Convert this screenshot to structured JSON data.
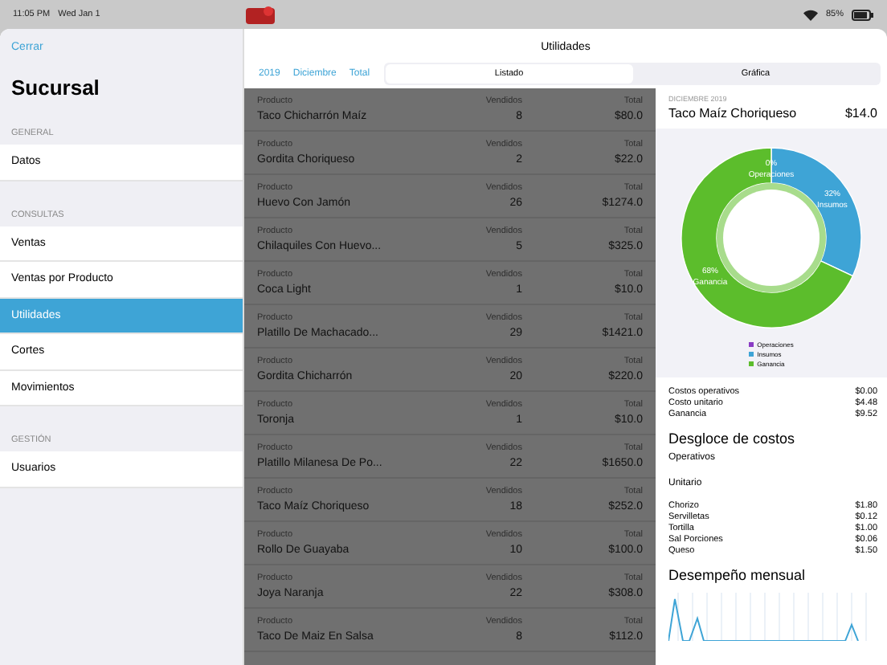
{
  "status_bar": {
    "time": "11:05 PM",
    "date": "Wed Jan 1",
    "battery": "85%"
  },
  "sidebar": {
    "close": "Cerrar",
    "title": "Sucursal",
    "sections": [
      {
        "heading": "GENERAL",
        "items": [
          {
            "label": "Datos",
            "selected": false
          }
        ]
      },
      {
        "heading": "CONSULTAS",
        "items": [
          {
            "label": "Ventas",
            "selected": false
          },
          {
            "label": "Ventas por Producto",
            "selected": false
          },
          {
            "label": "Utilidades",
            "selected": true
          },
          {
            "label": "Cortes",
            "selected": false
          },
          {
            "label": "Movimientos",
            "selected": false
          }
        ]
      },
      {
        "heading": "GESTIÓN",
        "items": [
          {
            "label": "Usuarios",
            "selected": false
          }
        ]
      }
    ]
  },
  "main": {
    "title": "Utilidades",
    "filters": [
      "2019",
      "Diciembre",
      "Total"
    ],
    "segments": [
      {
        "label": "Listado",
        "selected": true
      },
      {
        "label": "Gráfica",
        "selected": false
      }
    ]
  },
  "table": {
    "rows": [
      {
        "label_1": "Producto",
        "name": "Taco Chicharrón Maíz",
        "label_2": "Vendidos",
        "sold": "8",
        "label_3": "Total",
        "total": "$80.0"
      },
      {
        "label_1": "Producto",
        "name": "Gordita Choriqueso",
        "label_2": "Vendidos",
        "sold": "2",
        "label_3": "Total",
        "total": "$22.0"
      },
      {
        "label_1": "Producto",
        "name": "Huevo Con Jamón",
        "label_2": "Vendidos",
        "sold": "26",
        "label_3": "Total",
        "total": "$1274.0"
      },
      {
        "label_1": "Producto",
        "name": "Chilaquiles Con Huevo...",
        "label_2": "Vendidos",
        "sold": "5",
        "label_3": "Total",
        "total": "$325.0"
      },
      {
        "label_1": "Producto",
        "name": "Coca Light",
        "label_2": "Vendidos",
        "sold": "1",
        "label_3": "Total",
        "total": "$10.0"
      },
      {
        "label_1": "Producto",
        "name": "Platillo De Machacado...",
        "label_2": "Vendidos",
        "sold": "29",
        "label_3": "Total",
        "total": "$1421.0"
      },
      {
        "label_1": "Producto",
        "name": "Gordita Chicharrón",
        "label_2": "Vendidos",
        "sold": "20",
        "label_3": "Total",
        "total": "$220.0"
      },
      {
        "label_1": "Producto",
        "name": "Toronja",
        "label_2": "Vendidos",
        "sold": "1",
        "label_3": "Total",
        "total": "$10.0"
      },
      {
        "label_1": "Producto",
        "name": "Platillo Milanesa De Po...",
        "label_2": "Vendidos",
        "sold": "22",
        "label_3": "Total",
        "total": "$1650.0"
      },
      {
        "label_1": "Producto",
        "name": "Taco Maíz Choriqueso",
        "label_2": "Vendidos",
        "sold": "18",
        "label_3": "Total",
        "total": "$252.0"
      },
      {
        "label_1": "Producto",
        "name": "Rollo De Guayaba",
        "label_2": "Vendidos",
        "sold": "10",
        "label_3": "Total",
        "total": "$100.0"
      },
      {
        "label_1": "Producto",
        "name": "Joya Naranja",
        "label_2": "Vendidos",
        "sold": "22",
        "label_3": "Total",
        "total": "$308.0"
      },
      {
        "label_1": "Producto",
        "name": "Taco De Maiz En Salsa",
        "label_2": "Vendidos",
        "sold": "8",
        "label_3": "Total",
        "total": "$112.0"
      }
    ]
  },
  "detail": {
    "period": "DICIEMBRE 2019",
    "product": "Taco Maíz Choriqueso",
    "price": "$14.0",
    "chart_data": {
      "type": "donut",
      "categories": [
        "Operaciones",
        "Insumos",
        "Ganancia"
      ],
      "values": [
        0,
        32,
        68
      ],
      "colors": [
        "#8a3cc4",
        "#3ea4d6",
        "#5cbd2c"
      ],
      "value_labels": [
        "0%",
        "32%",
        "68%"
      ]
    },
    "summary": [
      {
        "label": "Costos operativos",
        "value": "$0.00"
      },
      {
        "label": "Costo unitario",
        "value": "$4.48"
      },
      {
        "label": "Ganancia",
        "value": "$9.52"
      }
    ],
    "breakdown_title": "Desgloce de costos",
    "operative_title": "Operativos",
    "unit_title": "Unitario",
    "unit_costs": [
      {
        "label": "Chorizo",
        "value": "$1.80"
      },
      {
        "label": "Servilletas",
        "value": "$0.12"
      },
      {
        "label": "Tortilla",
        "value": "$1.00"
      },
      {
        "label": "Sal Porciones",
        "value": "$0.06"
      },
      {
        "label": "Queso",
        "value": "$1.50"
      }
    ],
    "monthly_title": "Desempeño mensual"
  }
}
